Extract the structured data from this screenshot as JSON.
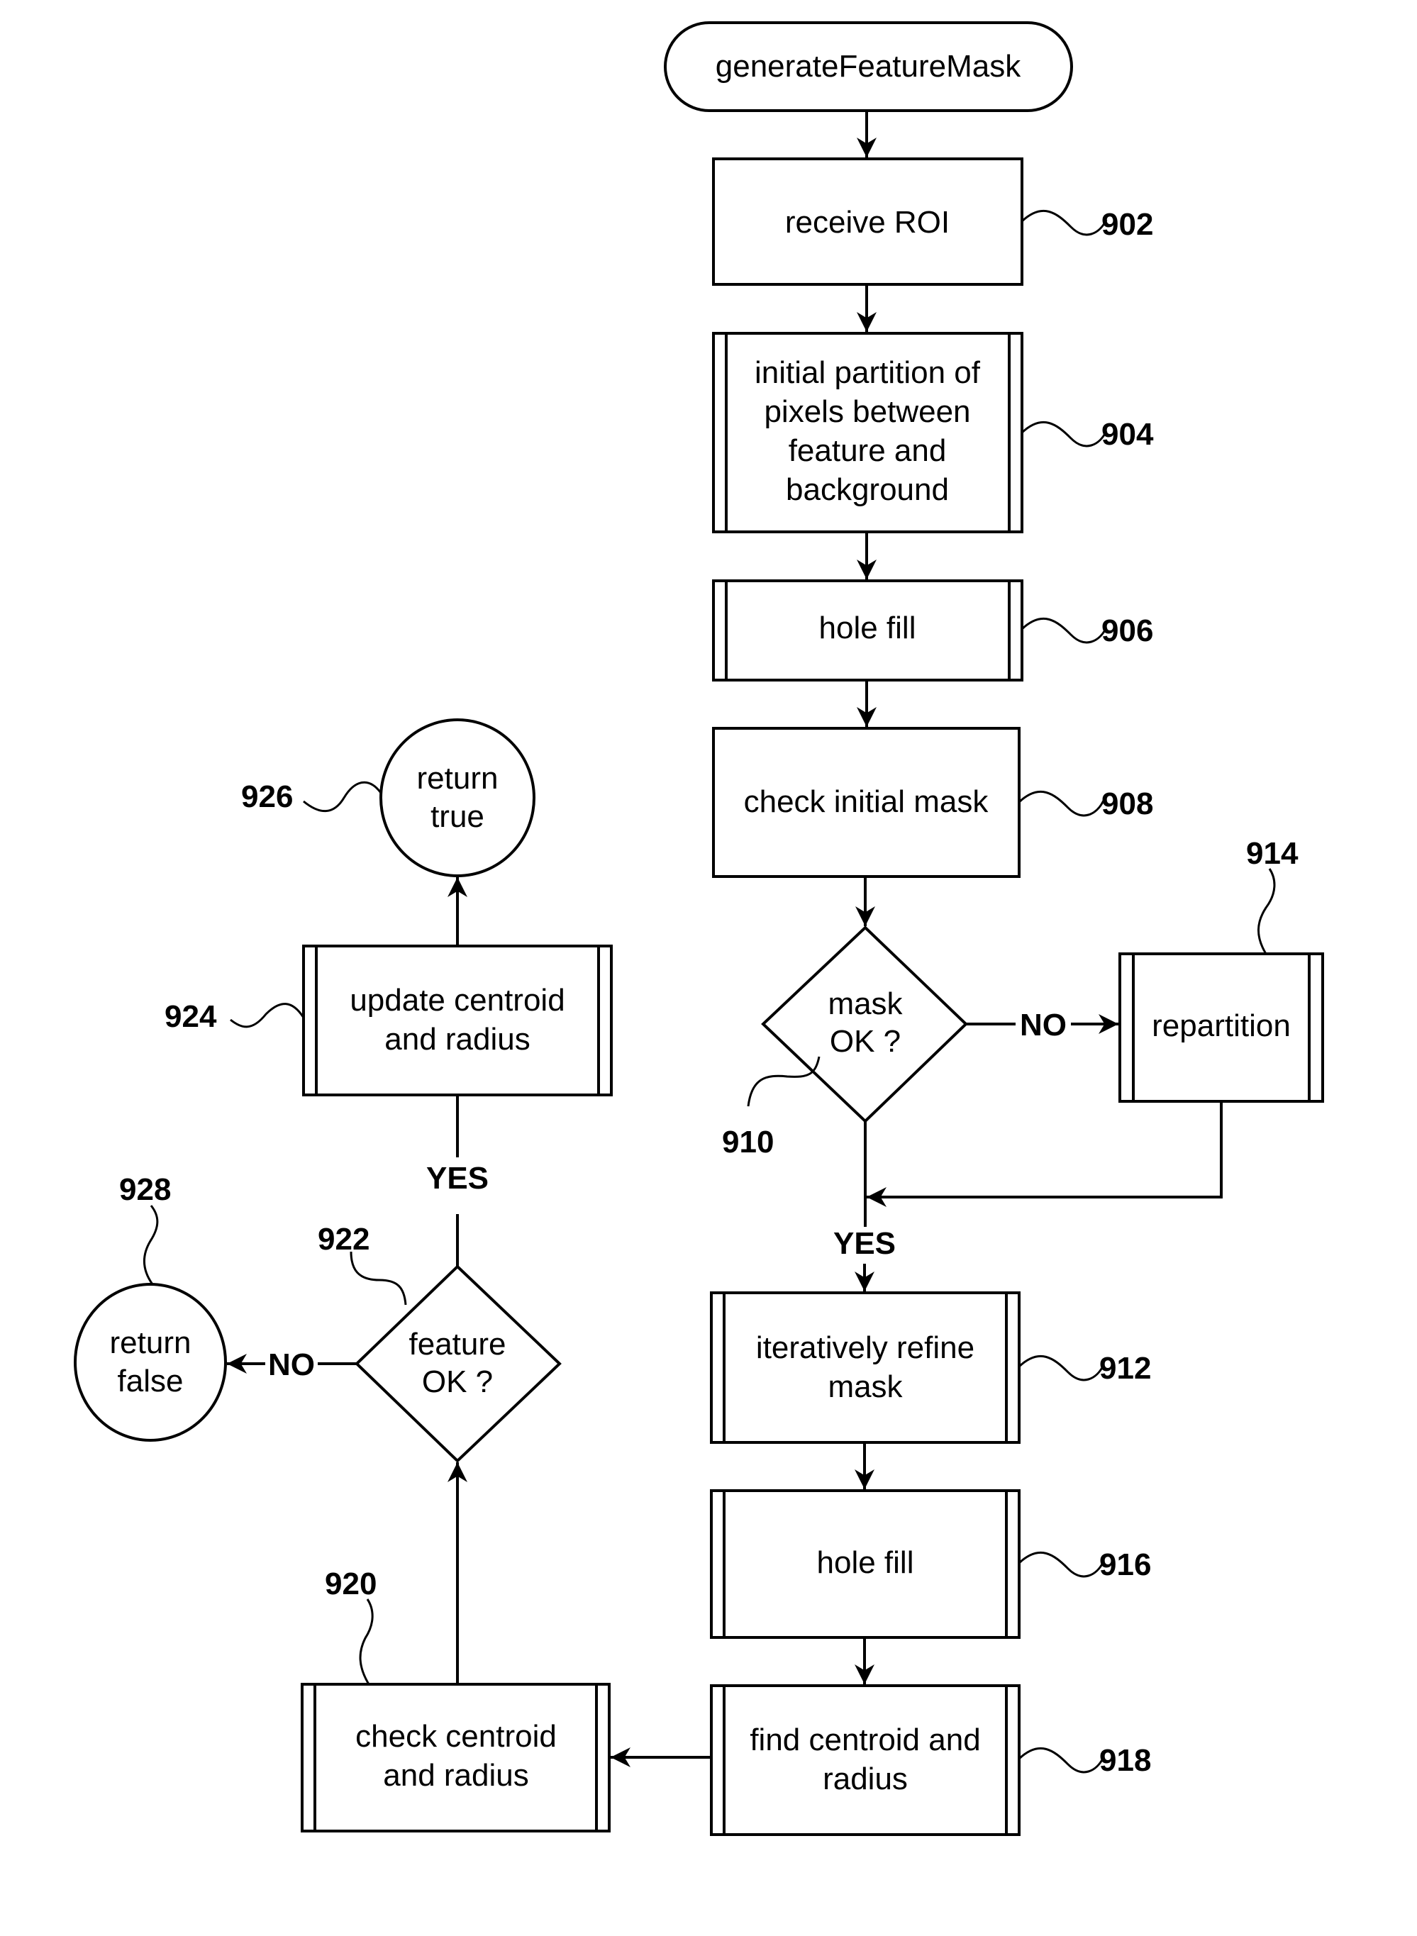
{
  "diagram": {
    "start": {
      "label": "generateFeatureMask"
    },
    "nodes": {
      "n902": {
        "ref": "902",
        "lines": [
          "receive ROI"
        ]
      },
      "n904": {
        "ref": "904",
        "lines": [
          "initial partition of",
          "pixels between",
          "feature and",
          "background"
        ]
      },
      "n906": {
        "ref": "906",
        "lines": [
          "hole fill"
        ]
      },
      "n908": {
        "ref": "908",
        "lines": [
          "check initial mask"
        ]
      },
      "n910": {
        "ref": "910",
        "lines": [
          "mask",
          "OK ?"
        ]
      },
      "n914": {
        "ref": "914",
        "lines": [
          "repartition"
        ]
      },
      "n912": {
        "ref": "912",
        "lines": [
          "iteratively refine",
          "mask"
        ]
      },
      "n916": {
        "ref": "916",
        "lines": [
          "hole fill"
        ]
      },
      "n918": {
        "ref": "918",
        "lines": [
          "find centroid and",
          "radius"
        ]
      },
      "n920": {
        "ref": "920",
        "lines": [
          "check centroid",
          "and radius"
        ]
      },
      "n922": {
        "ref": "922",
        "lines": [
          "feature",
          "OK ?"
        ]
      },
      "n924": {
        "ref": "924",
        "lines": [
          "update centroid",
          "and radius"
        ]
      },
      "n926": {
        "ref": "926",
        "lines": [
          "return",
          "true"
        ]
      },
      "n928": {
        "ref": "928",
        "lines": [
          "return",
          "false"
        ]
      }
    },
    "edge_labels": {
      "mask_no": "NO",
      "mask_yes": "YES",
      "feature_no": "NO",
      "feature_yes": "YES"
    }
  }
}
